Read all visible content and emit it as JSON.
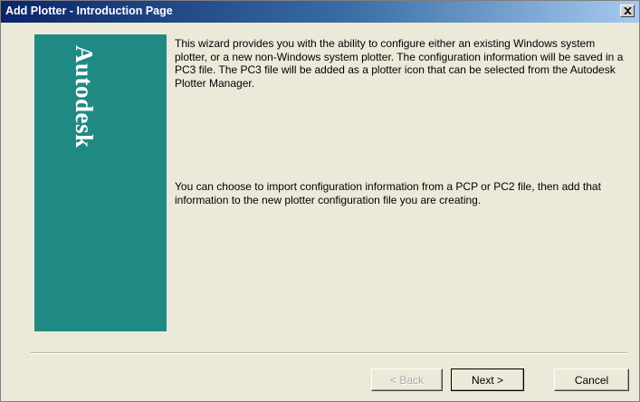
{
  "window": {
    "title": "Add Plotter - Introduction Page",
    "close_icon": "close-icon"
  },
  "brand": {
    "logo_text": "Autodesk",
    "panel_color": "#1f8a84"
  },
  "content": {
    "paragraph_1": "This wizard provides you with the ability to configure either an existing Windows system plotter, or a new non-Windows system plotter. The configuration information will be saved in a PC3 file. The PC3 file will be added as a plotter icon that can be selected from the Autodesk Plotter Manager.",
    "paragraph_2": "You can choose to import configuration information from a PCP or PC2 file, then add that information to the new plotter configuration file you are creating."
  },
  "buttons": {
    "back_label": "< Back",
    "next_label": "Next >",
    "cancel_label": "Cancel"
  }
}
